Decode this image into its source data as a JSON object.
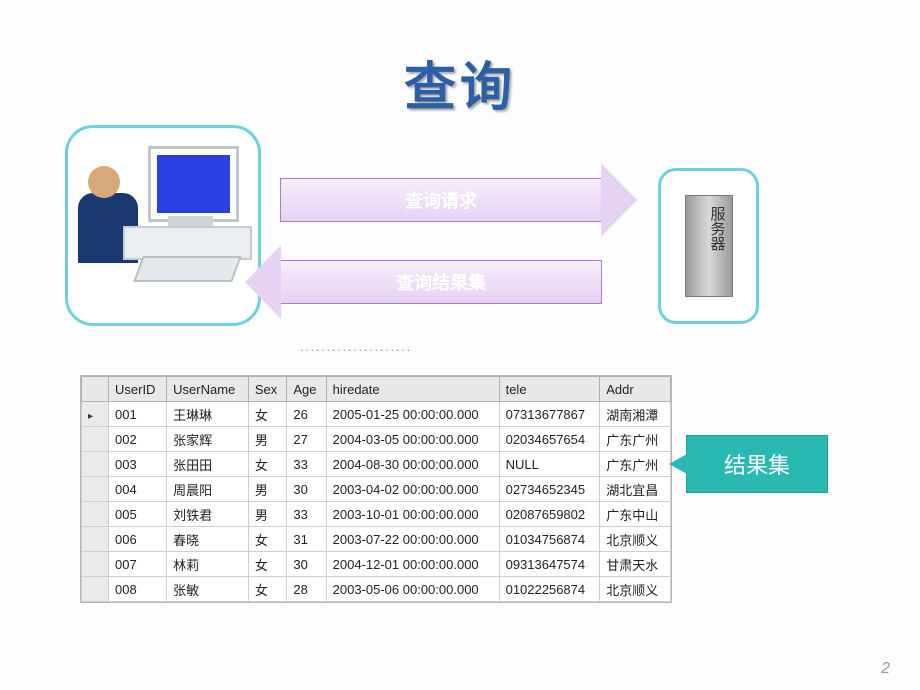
{
  "title": "查询",
  "arrows": {
    "request": "查询请求",
    "response": "查询结果集"
  },
  "server_label": "服务器",
  "result_callout": "结果集",
  "placeholder_dots": ".....................",
  "page_number": "2",
  "table": {
    "columns": [
      "UserID",
      "UserName",
      "Sex",
      "Age",
      "hiredate",
      "tele",
      "Addr"
    ],
    "rows": [
      {
        "UserID": "001",
        "UserName": "王琳琳",
        "Sex": "女",
        "Age": "26",
        "hiredate": "2005-01-25 00:00:00.000",
        "tele": "07313677867",
        "Addr": "湖南湘潭"
      },
      {
        "UserID": "002",
        "UserName": "张家辉",
        "Sex": "男",
        "Age": "27",
        "hiredate": "2004-03-05 00:00:00.000",
        "tele": "02034657654",
        "Addr": "广东广州"
      },
      {
        "UserID": "003",
        "UserName": "张田田",
        "Sex": "女",
        "Age": "33",
        "hiredate": "2004-08-30 00:00:00.000",
        "tele": "NULL",
        "Addr": "广东广州"
      },
      {
        "UserID": "004",
        "UserName": "周晨阳",
        "Sex": "男",
        "Age": "30",
        "hiredate": "2003-04-02 00:00:00.000",
        "tele": "02734652345",
        "Addr": "湖北宜昌"
      },
      {
        "UserID": "005",
        "UserName": "刘铁君",
        "Sex": "男",
        "Age": "33",
        "hiredate": "2003-10-01 00:00:00.000",
        "tele": "02087659802",
        "Addr": "广东中山"
      },
      {
        "UserID": "006",
        "UserName": "春晓",
        "Sex": "女",
        "Age": "31",
        "hiredate": "2003-07-22 00:00:00.000",
        "tele": "01034756874",
        "Addr": "北京顺义"
      },
      {
        "UserID": "007",
        "UserName": "林莉",
        "Sex": "女",
        "Age": "30",
        "hiredate": "2004-12-01 00:00:00.000",
        "tele": "09313647574",
        "Addr": "甘肃天水"
      },
      {
        "UserID": "008",
        "UserName": "张敏",
        "Sex": "女",
        "Age": "28",
        "hiredate": "2003-05-06 00:00:00.000",
        "tele": "01022256874",
        "Addr": "北京顺义"
      }
    ]
  }
}
